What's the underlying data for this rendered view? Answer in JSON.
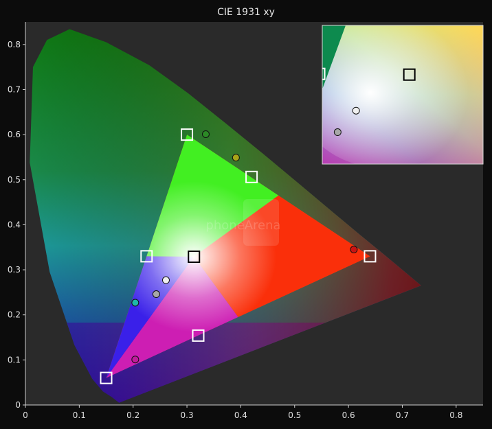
{
  "chart_data": {
    "type": "scatter",
    "title": "CIE 1931 xy",
    "xlabel": "",
    "ylabel": "",
    "xlim": [
      0,
      0.85
    ],
    "ylim": [
      0,
      0.85
    ],
    "x_ticks": [
      "0",
      "0.1",
      "0.2",
      "0.3",
      "0.4",
      "0.5",
      "0.6",
      "0.7",
      "0.8"
    ],
    "y_ticks": [
      "0",
      "0.1",
      "0.2",
      "0.3",
      "0.4",
      "0.5",
      "0.6",
      "0.7",
      "0.8"
    ],
    "grid": false,
    "legend": "none",
    "spectral_locus": [
      {
        "x": 0.174,
        "y": 0.005
      },
      {
        "x": 0.16,
        "y": 0.018
      },
      {
        "x": 0.144,
        "y": 0.03
      },
      {
        "x": 0.124,
        "y": 0.058
      },
      {
        "x": 0.091,
        "y": 0.133
      },
      {
        "x": 0.045,
        "y": 0.295
      },
      {
        "x": 0.008,
        "y": 0.538
      },
      {
        "x": 0.014,
        "y": 0.75
      },
      {
        "x": 0.04,
        "y": 0.81
      },
      {
        "x": 0.082,
        "y": 0.834
      },
      {
        "x": 0.15,
        "y": 0.805
      },
      {
        "x": 0.23,
        "y": 0.754
      },
      {
        "x": 0.302,
        "y": 0.692
      },
      {
        "x": 0.373,
        "y": 0.624
      },
      {
        "x": 0.444,
        "y": 0.555
      },
      {
        "x": 0.512,
        "y": 0.487
      },
      {
        "x": 0.575,
        "y": 0.424
      },
      {
        "x": 0.627,
        "y": 0.372
      },
      {
        "x": 0.669,
        "y": 0.331
      },
      {
        "x": 0.735,
        "y": 0.265
      }
    ],
    "reference_gamut": [
      {
        "x": 0.64,
        "y": 0.33
      },
      {
        "x": 0.3,
        "y": 0.6
      },
      {
        "x": 0.15,
        "y": 0.06
      }
    ],
    "reference_targets": [
      {
        "x": 0.64,
        "y": 0.33
      },
      {
        "x": 0.3,
        "y": 0.6
      },
      {
        "x": 0.15,
        "y": 0.06
      },
      {
        "x": 0.313,
        "y": 0.329
      },
      {
        "x": 0.42,
        "y": 0.506
      },
      {
        "x": 0.225,
        "y": 0.33
      },
      {
        "x": 0.321,
        "y": 0.154
      }
    ],
    "measured_points": [
      {
        "x": 0.61,
        "y": 0.345,
        "color": "#c81414"
      },
      {
        "x": 0.335,
        "y": 0.601,
        "color": "#2c8a26"
      },
      {
        "x": 0.391,
        "y": 0.549,
        "color": "#a8a418"
      },
      {
        "x": 0.261,
        "y": 0.277,
        "color": "#f0f0f0"
      },
      {
        "x": 0.243,
        "y": 0.246,
        "color": "#a8a8a8"
      },
      {
        "x": 0.204,
        "y": 0.227,
        "color": "#1fb8aa"
      },
      {
        "x": 0.204,
        "y": 0.101,
        "color": "#c01c9c"
      }
    ],
    "inset": {
      "xlim": [
        0.228,
        0.385
      ],
      "ylim": [
        0.2,
        0.4
      ],
      "targets": [
        {
          "x": 0.313,
          "y": 0.329
        },
        {
          "x": 0.225,
          "y": 0.33
        }
      ],
      "points": [
        {
          "x": 0.261,
          "y": 0.277,
          "color": "#f0f0f0"
        },
        {
          "x": 0.243,
          "y": 0.246,
          "color": "#a8a8a8"
        }
      ]
    },
    "colors": {
      "plot_bg": "#2a2a2a",
      "target_white": "#ffffff",
      "target_black": "#000000"
    }
  },
  "watermark": "phoneArena"
}
